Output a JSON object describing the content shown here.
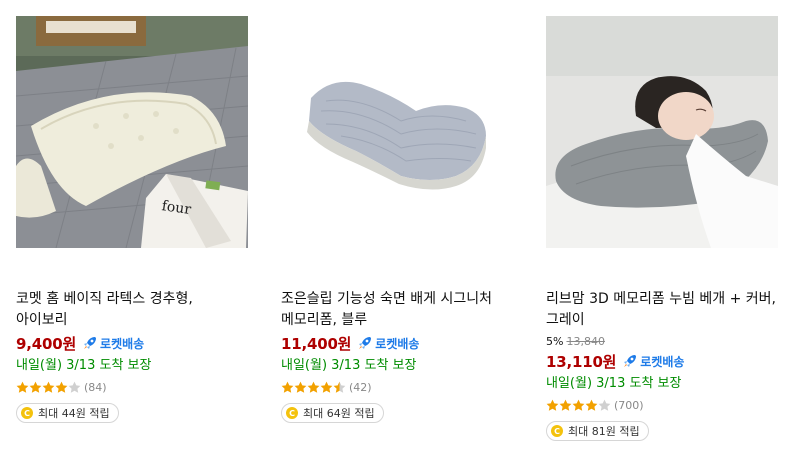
{
  "colors": {
    "price": "#ae0000",
    "rocket_blue": "#1e7be8",
    "delivery_green": "#008c00",
    "star": "#f2a100",
    "coin": "#f4c20d"
  },
  "products": [
    {
      "title": "코멧 홈 베이직 라텍스 경추형, 아이보리",
      "image_icon": "latex-pillow-photo",
      "discount": "",
      "original_price": "",
      "price": "9,400원",
      "rocket_label": "로켓배송",
      "delivery": "내일(월) 3/13 도착 보장",
      "rating": 4.0,
      "review_count": "(84)",
      "reward": "최대 44원 적립",
      "coin_letter": "C"
    },
    {
      "title": "조은슬립 기능성 숙면 배게 시그니처 메모리폼, 블루",
      "image_icon": "memory-foam-pillow-photo",
      "discount": "",
      "original_price": "",
      "price": "11,400원",
      "rocket_label": "로켓배송",
      "delivery": "내일(월) 3/13 도착 보장",
      "rating": 4.5,
      "review_count": "(42)",
      "reward": "최대 64원 적립",
      "coin_letter": "C"
    },
    {
      "title": "리브맘 3D 메모리폼 누빔 베개 + 커버, 그레이",
      "image_icon": "woman-sleeping-pillow-photo",
      "discount": "5%",
      "original_price": "13,840",
      "price": "13,110원",
      "rocket_label": "로켓배송",
      "delivery": "내일(월) 3/13 도착 보장",
      "rating": 4.0,
      "review_count": "(700)",
      "reward": "최대 81원 적립",
      "coin_letter": "C"
    }
  ]
}
